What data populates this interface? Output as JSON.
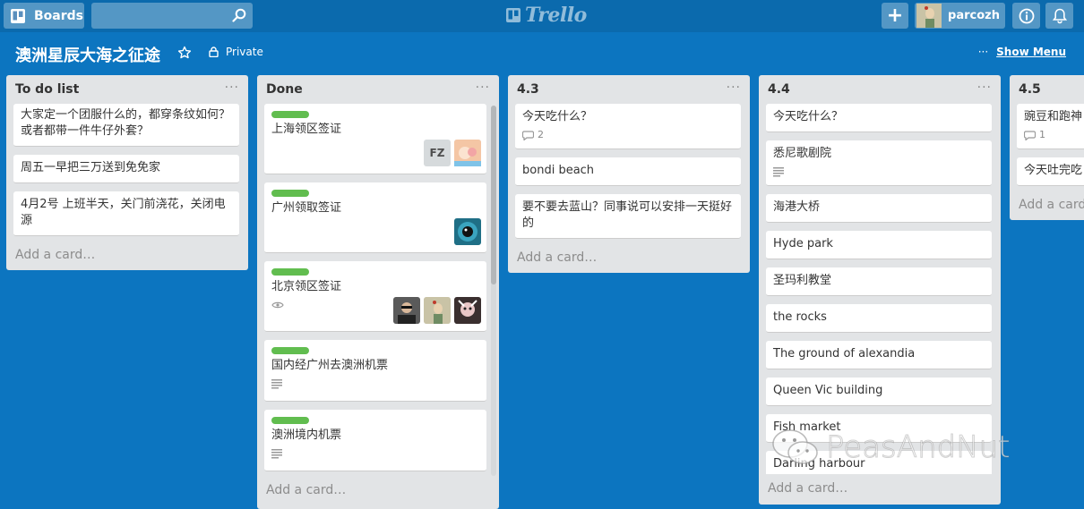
{
  "header": {
    "boards_label": "Boards",
    "search_placeholder": "",
    "logo_text": "Trello",
    "add_label": "+",
    "user_name": "parcozh"
  },
  "board": {
    "title": "澳洲星辰大海之征途",
    "visibility": "Private",
    "menu_dots": "···",
    "show_menu": "Show Menu"
  },
  "lists": [
    {
      "title": "To do list",
      "menu": "···",
      "cards": [
        {
          "text": "大家定一个团服什么的，都穿条纹如何？或者都带一件牛仔外套？"
        },
        {
          "text": "周五一早把三万送到免免家"
        },
        {
          "text": "4月2号 上班半天，关门前浇花，关闭电源"
        }
      ],
      "add_card": "Add a card…"
    },
    {
      "title": "Done",
      "menu": "···",
      "cards": [
        {
          "label": "green",
          "text": "上海领区签证",
          "members": [
            "FZ",
            "avatar"
          ]
        },
        {
          "label": "green",
          "text": "广州领取签证",
          "members": [
            "avatar"
          ]
        },
        {
          "label": "green",
          "text": "北京领区签证",
          "badge": "eye-icon",
          "members": [
            "avatar",
            "avatar",
            "avatar"
          ]
        },
        {
          "label": "green",
          "text": "国内经广州去澳洲机票",
          "badge": "description-icon"
        },
        {
          "label": "green",
          "text": "澳洲境内机票",
          "badge": "description-icon"
        }
      ],
      "add_card": "Add a card…"
    },
    {
      "title": "4.3",
      "menu": "···",
      "cards": [
        {
          "text": "今天吃什么？",
          "comments": "2"
        },
        {
          "text": "bondi beach"
        },
        {
          "text": "要不要去蓝山？同事说可以安排一天挺好的"
        }
      ],
      "add_card": "Add a card…"
    },
    {
      "title": "4.4",
      "menu": "···",
      "cards": [
        {
          "text": "今天吃什么？"
        },
        {
          "text": "悉尼歌剧院",
          "badge": "description-icon"
        },
        {
          "text": "海港大桥"
        },
        {
          "text": "Hyde park"
        },
        {
          "text": "圣玛利教堂"
        },
        {
          "text": "the rocks"
        },
        {
          "text": "The ground of alexandia"
        },
        {
          "text": "Queen Vic building"
        },
        {
          "text": "Fish market"
        },
        {
          "text": "Darling harbour"
        }
      ],
      "add_card": "Add a card…"
    },
    {
      "title": "4.5",
      "menu": "···",
      "cards": [
        {
          "text": "豌豆和跑神",
          "comments": "1"
        },
        {
          "text": "今天吐完吃"
        }
      ],
      "add_card": "Add a card…"
    }
  ],
  "watermark": "PeasAndNut",
  "colors": {
    "board_bg": "#0c75c0",
    "header_bg": "#0b6aad",
    "list_bg": "#e2e4e6",
    "label_green": "#61bd4f"
  }
}
